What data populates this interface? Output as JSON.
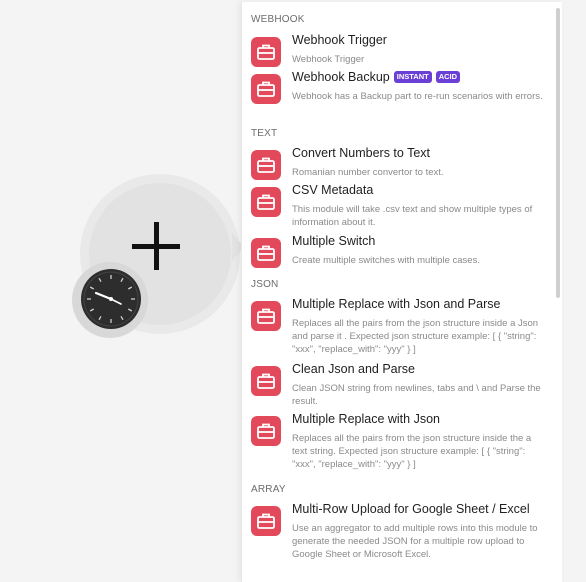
{
  "canvas": {
    "module_action": "add-module",
    "trigger_icon": "clock-icon"
  },
  "panel": {
    "sections": [
      {
        "title": "WEBHOOK",
        "items": [
          {
            "title": "Webhook Trigger",
            "desc": "Webhook Trigger",
            "icon": "toolbox-icon"
          },
          {
            "title": "Webhook Backup",
            "badges": [
              "INSTANT",
              "ACID"
            ],
            "desc": "Webhook has a Backup part to re-run scenarios with errors.",
            "icon": "toolbox-icon"
          }
        ]
      },
      {
        "title": "TEXT",
        "items": [
          {
            "title": "Convert Numbers to Text",
            "desc": "Romanian number convertor to text.",
            "icon": "toolbox-icon"
          },
          {
            "title": "CSV Metadata",
            "desc": "This module will take .csv text and show multiple types of information about it.",
            "icon": "toolbox-icon"
          },
          {
            "title": "Multiple Switch",
            "desc": "Create multiple switches with multiple cases.",
            "icon": "toolbox-icon"
          }
        ]
      },
      {
        "title": "JSON",
        "items": [
          {
            "title": "Multiple Replace with Json and Parse",
            "desc": "Replaces all the pairs from the json structure inside a Json and parse it . Expected json structure example: [ { \"string\": \"xxx\", \"replace_with\": \"yyy\" } ]",
            "icon": "toolbox-icon"
          },
          {
            "title": "Clean Json and Parse",
            "desc": "Clean JSON string from newlines, tabs and \\ and Parse the result.",
            "icon": "toolbox-icon"
          },
          {
            "title": "Multiple Replace with Json",
            "desc": "Replaces all the pairs from the json structure inside the a text string. Expected json structure example: [ { \"string\": \"xxx\", \"replace_with\": \"yyy\" } ]",
            "icon": "toolbox-icon"
          }
        ]
      },
      {
        "title": "ARRAY",
        "items": [
          {
            "title": "Multi-Row Upload for Google Sheet / Excel",
            "desc": "Use an aggregator to add multiple rows into this module to generate the needed JSON for a multiple row upload to Google Sheet or Microsoft Excel.",
            "icon": "toolbox-icon"
          }
        ]
      }
    ]
  },
  "colors": {
    "icon_bg": "#e24a5c",
    "badge_bg": "#6a3fd6",
    "canvas_bg": "#f4f4f4"
  }
}
